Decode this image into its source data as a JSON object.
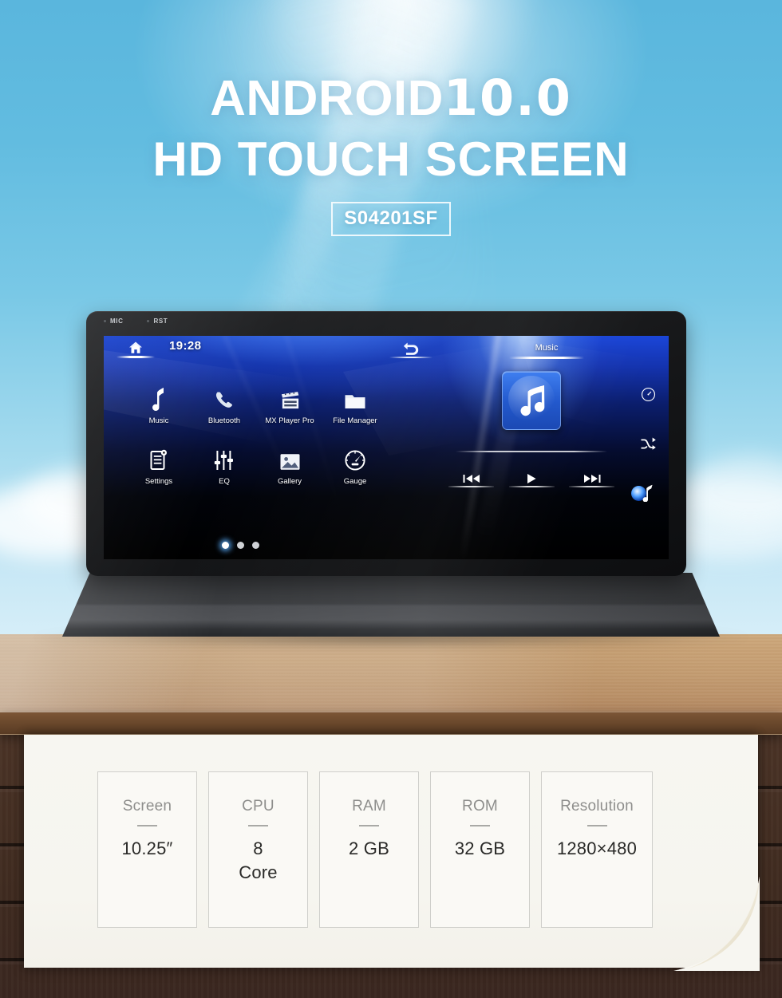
{
  "hero": {
    "title_main": "ANDROID",
    "title_version": "10.0",
    "subtitle": "HD TOUCH SCREEN",
    "model_badge": "S04201SF"
  },
  "device": {
    "bezel_labels": [
      "MIC",
      "RST"
    ],
    "screen": {
      "topbar": {
        "home_icon": "home-icon",
        "clock": "19:28",
        "back_icon": "back-arrow-icon",
        "tab_label": "Music"
      },
      "apps": [
        {
          "label": "Music",
          "icon": "music-note-icon"
        },
        {
          "label": "Bluetooth",
          "icon": "phone-handset-icon"
        },
        {
          "label": "MX Player Pro",
          "icon": "film-clapper-icon"
        },
        {
          "label": "File Manager",
          "icon": "folder-icon"
        },
        {
          "label": "Settings",
          "icon": "settings-list-icon"
        },
        {
          "label": "EQ",
          "icon": "equalizer-sliders-icon"
        },
        {
          "label": "Gallery",
          "icon": "image-picture-icon"
        },
        {
          "label": "Gauge",
          "icon": "speedometer-icon"
        }
      ],
      "page_dots": {
        "count": 3,
        "active_index": 0
      },
      "player": {
        "album_art_icon": "music-note-album-icon",
        "prev_icon": "previous-track-icon",
        "play_icon": "play-icon",
        "next_icon": "next-track-icon"
      },
      "sidebar_icons": [
        "compass-clock-icon",
        "shuffle-icon",
        "music-note-icon"
      ]
    }
  },
  "specs": {
    "items": [
      {
        "label": "Screen",
        "value": "10.25″"
      },
      {
        "label": "CPU",
        "value": "8\nCore"
      },
      {
        "label": "RAM",
        "value": "2 GB"
      },
      {
        "label": "ROM",
        "value": "32 GB"
      },
      {
        "label": "Resolution",
        "value": "1280×480"
      }
    ]
  },
  "colors": {
    "sky_light": "#8fd0e9",
    "sky_dark": "#3f9ccd",
    "screen_blue": "#1b46d8",
    "panel_bg": "#f7f6f1",
    "wood_top": "#c9a377",
    "wood_floor": "#4a3326"
  }
}
